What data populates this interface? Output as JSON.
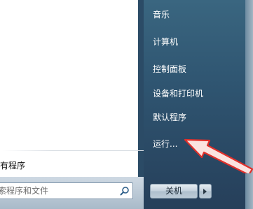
{
  "left_pane": {
    "all_programs": "所有程序"
  },
  "search": {
    "placeholder_text": "搜索程序和文件",
    "icon": "search-icon"
  },
  "right_menu": {
    "items": [
      {
        "label": "音乐"
      },
      {
        "label": "计算机"
      },
      {
        "label": "控制面板"
      },
      {
        "label": "设备和打印机"
      },
      {
        "label": "默认程序"
      },
      {
        "label": "运行..."
      }
    ]
  },
  "shutdown": {
    "label": "关机",
    "arrow_icon": "triangle-right-icon"
  },
  "annotation": {
    "type": "red-arrow-pointing-left",
    "color": "#e0302b"
  }
}
